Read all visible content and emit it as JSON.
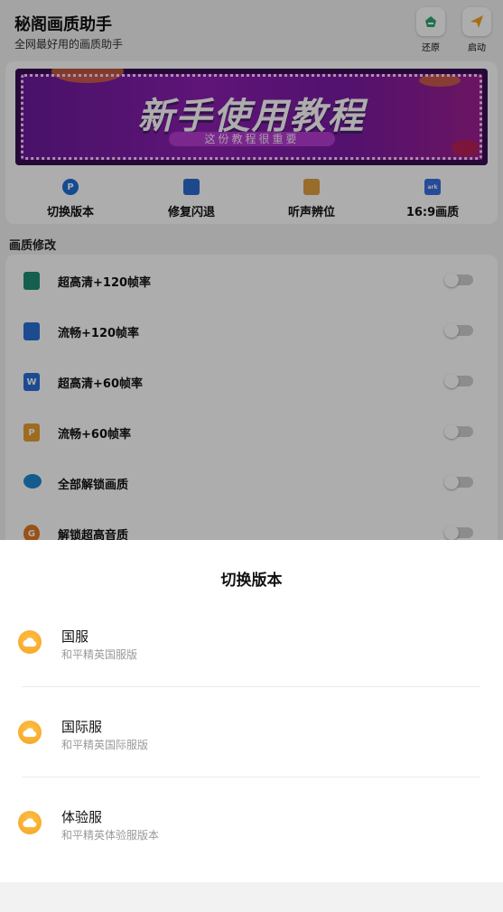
{
  "header": {
    "title": "秘阁画质助手",
    "subtitle": "全网最好用的画质助手",
    "restore_label": "还原",
    "launch_label": "启动"
  },
  "banner": {
    "title": "新手使用教程",
    "subtitle": "这份教程很重要"
  },
  "quick_actions": [
    {
      "label": "切换版本",
      "icon": "p-circle-icon",
      "color": "#1e6fd9"
    },
    {
      "label": "修复闪退",
      "icon": "box-icon",
      "color": "#2d6ad0"
    },
    {
      "label": "听声辨位",
      "icon": "book-icon",
      "color": "#e0a040"
    },
    {
      "label": "16:9画质",
      "icon": "aspect-icon",
      "color": "#3a6fe0"
    }
  ],
  "section_title": "画质修改",
  "settings": [
    {
      "label": "超高清+120帧率",
      "icon": "sheet-icon",
      "color": "#1f8c74",
      "on": false
    },
    {
      "label": "流畅+120帧率",
      "icon": "doc-stack-icon",
      "color": "#2a6fd8",
      "on": false
    },
    {
      "label": "超高清+60帧率",
      "icon": "word-doc-icon",
      "color": "#2a6fd8",
      "on": false
    },
    {
      "label": "流畅+60帧率",
      "icon": "ppt-doc-icon",
      "color": "#e8a030",
      "on": false
    },
    {
      "label": "全部解锁画质",
      "icon": "cloud-drive-icon",
      "color": "#1e88d0",
      "on": false
    },
    {
      "label": "解锁超高音质",
      "icon": "music-icon",
      "color": "#e07a20",
      "on": false
    }
  ],
  "sheet": {
    "title": "切换版本",
    "options": [
      {
        "title": "国服",
        "subtitle": "和平精英国服版"
      },
      {
        "title": "国际服",
        "subtitle": "和平精英国际服版"
      },
      {
        "title": "体验服",
        "subtitle": "和平精英体验服版本"
      }
    ]
  }
}
